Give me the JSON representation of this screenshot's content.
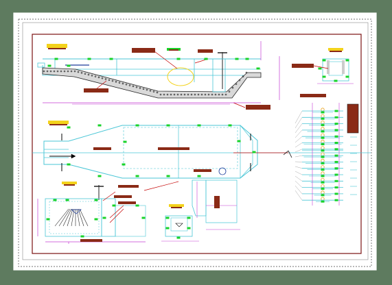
{
  "app": {
    "title": ""
  },
  "colors": {
    "background": "#5e7b5f",
    "sheet": "#ffffff",
    "border_red": "#7a1010",
    "cyan": "#49c6d6",
    "green": "#19d32a",
    "label_brown": "#8a2a16",
    "dim_magenta": "#c43bd3",
    "leader_red": "#c40000",
    "circle_orange": "#e7a117",
    "gray": "#a9a9a9",
    "yellow": "#f3d21b",
    "black": "#111111"
  },
  "diagram": {
    "nodes": [
      {
        "id": "longitudinal-section",
        "label": ""
      },
      {
        "id": "plan-view",
        "label": ""
      },
      {
        "id": "tank-section",
        "label": ""
      },
      {
        "id": "small-cross-section",
        "label": ""
      },
      {
        "id": "top-right-detail",
        "label": ""
      },
      {
        "id": "stair-schedule",
        "label": ""
      },
      {
        "id": "drain-detail",
        "label": ""
      }
    ],
    "edges": []
  },
  "icons": [
    "valve-icon",
    "north-arrow-icon",
    "cut-line-icon",
    "hatched-gravel-icon"
  ]
}
